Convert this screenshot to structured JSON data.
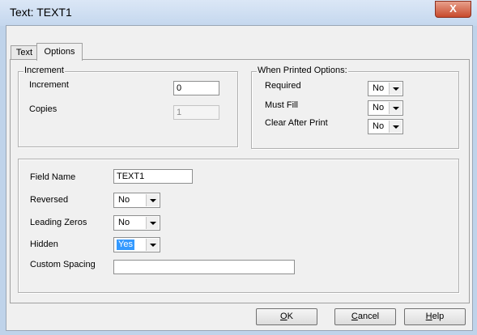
{
  "window": {
    "title": "Text: TEXT1",
    "close_glyph": "X"
  },
  "tabs": [
    {
      "label": "Text"
    },
    {
      "label": "Options"
    }
  ],
  "increment_group": {
    "label": "Increment",
    "increment_label": "Increment",
    "increment_value": "0",
    "copies_label": "Copies",
    "copies_value": "1"
  },
  "printed_options": {
    "label": "When Printed Options:",
    "required_label": "Required",
    "required_value": "No",
    "must_fill_label": "Must Fill",
    "must_fill_value": "No",
    "clear_label": "Clear After Print",
    "clear_value": "No"
  },
  "field_group": {
    "field_name_label": "Field Name",
    "field_name_value": "TEXT1",
    "reversed_label": "Reversed",
    "reversed_value": "No",
    "leading_zeros_label": "Leading Zeros",
    "leading_zeros_value": "No",
    "hidden_label": "Hidden",
    "hidden_value": "Yes",
    "custom_spacing_label": "Custom Spacing",
    "custom_spacing_value": ""
  },
  "buttons": {
    "ok_acc": "O",
    "ok_rest": "K",
    "cancel_acc": "C",
    "cancel_rest": "ancel",
    "help_acc": "H",
    "help_rest": "elp"
  }
}
